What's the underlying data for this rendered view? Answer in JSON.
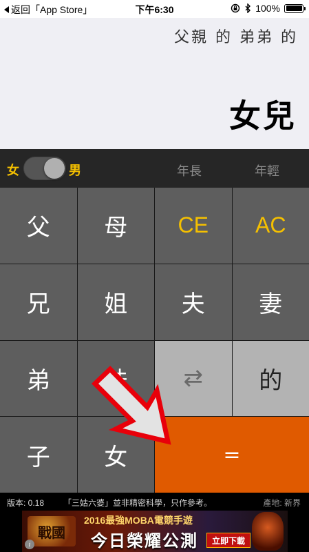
{
  "status_bar": {
    "back_label": "返回「App Store」",
    "time": "下午6:30",
    "battery": "100%"
  },
  "display": {
    "expression": "父親 的 弟弟 的",
    "result": "女兒"
  },
  "controls": {
    "female_label": "女",
    "male_label": "男",
    "gender_toggle_on": true,
    "older_label": "年長",
    "younger_label": "年輕"
  },
  "keys": {
    "father": "父",
    "mother": "母",
    "ce": "CE",
    "ac": "AC",
    "elder_brother": "兄",
    "elder_sister": "姐",
    "husband": "夫",
    "wife": "妻",
    "younger_brother": "弟",
    "younger_sister": "妹",
    "swap": "⇄",
    "of": "的",
    "son": "子",
    "daughter": "女",
    "equals": "="
  },
  "footer": {
    "version": "版本: 0.18",
    "disclaimer": "「三姑六婆」並非精密科學，只作參考。",
    "origin": "產地: 新界"
  },
  "ad": {
    "logo_text": "戰國",
    "headline": "2016最強MOBA電競手遊",
    "tagline": "今日榮耀公測",
    "cta": "立即下載",
    "info": "i"
  },
  "colors": {
    "accent": "#f5c000",
    "equals_key": "#e05a00",
    "key_dark": "#5e5e5e",
    "key_light": "#b3b3b3",
    "arrow_outline": "#e8000a"
  },
  "icons": {
    "back": "chevron-left-icon",
    "rotation_lock": "rotation-lock-icon",
    "bluetooth": "bluetooth-icon",
    "battery": "battery-icon",
    "overlay_arrow": "red-arrow-icon"
  }
}
